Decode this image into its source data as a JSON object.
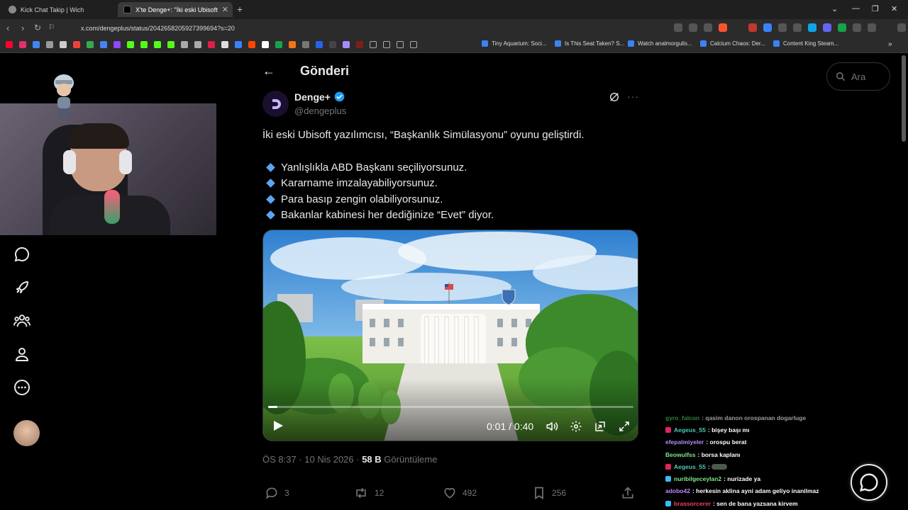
{
  "browser": {
    "tabs": [
      {
        "label": "Kick Chat Takip | Wich",
        "active": false
      },
      {
        "label": "X'te Denge+: \"İki eski Ubisoft ya",
        "active": true
      }
    ],
    "url": "x.com/dengeplus/status/2042658205927399694?s=20",
    "bookmarks": [
      "Tiny Aquarium: Soci...",
      "Is This Seat Taken? S...",
      "Watch analmorgulis...",
      "Calcium Chaos: Der...",
      "Content King Steam..."
    ]
  },
  "header": {
    "title": "Gönderi"
  },
  "search": {
    "placeholder": "Ara"
  },
  "tweet": {
    "author_name": "Denge+",
    "handle": "@dengeplus",
    "text": "İki eski Ubisoft yazılımcısı, “Başkanlık Simülasyonu” oyunu geliştirdi.",
    "bullets": [
      "Yanlışlıkla ABD Başkanı seçiliyorsunuz.",
      "Kararname imzalayabiliyorsunuz.",
      "Para basıp zengin olabiliyorsunuz.",
      "Bakanlar kabinesi her dediğinize “Evet” diyor."
    ],
    "video": {
      "time": "0:01 / 0:40",
      "progress_fraction": 0.025
    },
    "time_posted": "ÖS 8:37 · 10 Nis 2026 · ",
    "views_count": "58 B",
    "views_label": " Görüntüleme",
    "actions": {
      "replies": "3",
      "reposts": "12",
      "likes": "492",
      "bookmarks": "256"
    }
  },
  "chat": [
    {
      "user": "gyro_falcon",
      "msg": ": qasim danon orospanan dogarluge",
      "color": "#56d364",
      "badge": ""
    },
    {
      "user": "Aegeus_55",
      "msg": ": bişey başı mı",
      "color": "#4ec9b0",
      "badge": "#e0245e"
    },
    {
      "user": "efepalmiyeler",
      "msg": ": orospu berat",
      "color": "#b48ef5",
      "badge": ""
    },
    {
      "user": "Beowulfss",
      "msg": ": borsa kaplanı",
      "color": "#7ee787",
      "badge": ""
    },
    {
      "user": "Aegeus_55",
      "msg": ":",
      "color": "#4ec9b0",
      "badge": "#e0245e",
      "emote": true
    },
    {
      "user": "nuribilgeceylan2",
      "msg": ": nurizade ya",
      "color": "#7ee787",
      "badge": "#38bdf8"
    },
    {
      "user": "adobo42",
      "msg": ": herkesin aklina ayni adam geliyo inanilmaz",
      "color": "#c084fc",
      "badge": ""
    },
    {
      "user": "brassorcerer",
      "msg": ": sen de bana yazsana kirvem",
      "color": "#f43f5e",
      "badge": "#38bdf8"
    }
  ],
  "colors": {
    "accent": "#1d9bf0",
    "bullet_diamond": "#5aa6ef",
    "muted": "#71767b"
  }
}
